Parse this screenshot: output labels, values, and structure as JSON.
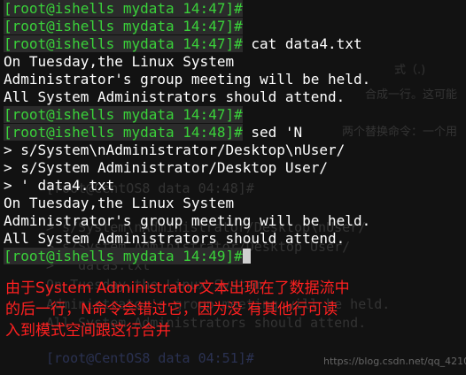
{
  "terminal": {
    "lines": [
      {
        "prompt": "[root@ishells mydata 14:47]#",
        "text": ""
      },
      {
        "prompt": "[root@ishells mydata 14:47]#",
        "text": ""
      },
      {
        "prompt": "[root@ishells mydata 14:47]#",
        "text": " cat data4.txt"
      },
      {
        "prompt": "",
        "text": "On Tuesday,the Linux System"
      },
      {
        "prompt": "",
        "text": "Administrator's group meeting will be held."
      },
      {
        "prompt": "",
        "text": "All System Administrators should attend."
      },
      {
        "prompt": "[root@ishells mydata 14:47]#",
        "text": ""
      },
      {
        "prompt": "[root@ishells mydata 14:48]#",
        "text": " sed 'N"
      },
      {
        "prompt": "",
        "text": "> s/System\\nAdministrator/Desktop\\nUser/"
      },
      {
        "prompt": "",
        "text": "> s/System Administrator/Desktop User/"
      },
      {
        "prompt": "",
        "text": "> ' data4.txt"
      },
      {
        "prompt": "",
        "text": "On Tuesday,the Linux System"
      },
      {
        "prompt": "",
        "text": "Administrator's group meeting will be held."
      },
      {
        "prompt": "",
        "text": "All System Administrators should attend."
      },
      {
        "prompt": "[root@ishells mydata 14:49]#",
        "text": ""
      }
    ]
  },
  "annotation": {
    "lines": [
      "由于System Administrator文本出现在了数据流中",
      "的后一行，N命令会错过它，因为没 有其他行可读",
      "入到模式空间跟这行合并"
    ]
  },
  "background_ghost": {
    "lines": [
      {
        "text": "式（.)",
        "kind": "cjk"
      },
      {
        "text": "合成一行。这可能",
        "kind": "cjk"
      },
      {
        "text": "两个替换命令：一个用",
        "kind": "cjk"
      },
      {
        "text": "[root@CentOS8 data 04:48]#",
        "kind": "term"
      },
      {
        "text": "> s/System\\nAdministrator/Desktop\\nUser/",
        "kind": "term"
      },
      {
        "text": "> s/System Administrator/Desktop User/",
        "kind": "term"
      },
      {
        "text": "> ' data3.txt",
        "kind": "term"
      },
      {
        "text": "On Tuesday,the Linux System",
        "kind": "term"
      },
      {
        "text": "Administrator's group meeting will be held.",
        "kind": "term"
      },
      {
        "text": "All System Administrators should attend.",
        "kind": "term"
      },
      {
        "text": "[root@CentOS8 data 04:51]#",
        "kind": "term-blue"
      }
    ]
  },
  "watermark": "https://blog.csdn.net/qq_42103",
  "colors": {
    "prompt_green": "#3ad13a",
    "terminal_text": "#ffffff",
    "terminal_bg": "#121212",
    "annotation_red": "#ff2020"
  }
}
